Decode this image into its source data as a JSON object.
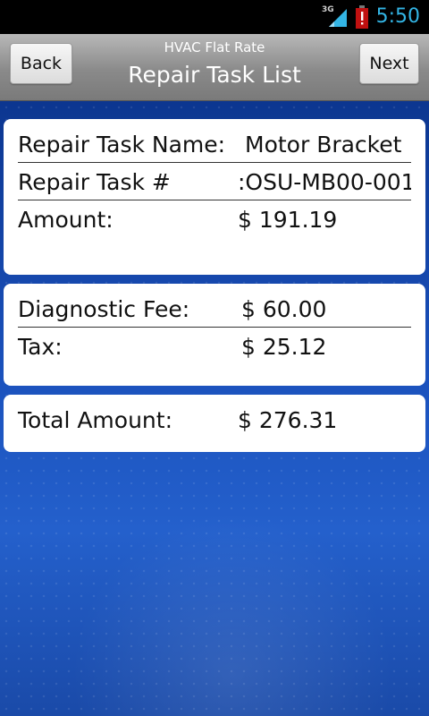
{
  "status_bar": {
    "network_type": "3G",
    "time": "5:50",
    "icons": [
      "signal-icon",
      "battery-alert-icon"
    ],
    "clock_color": "#33b5e5"
  },
  "header": {
    "app_title": "HVAC Flat Rate",
    "screen_title": "Repair Task List",
    "back_label": "Back",
    "next_label": "Next"
  },
  "task_card": {
    "rows": [
      {
        "label": "Repair Task Name:",
        "value": "Motor Bracket"
      },
      {
        "label": "Repair Task #",
        "value": ":OSU-MB00-001"
      },
      {
        "label": "Amount:",
        "value": "$ 191.19"
      }
    ]
  },
  "fees_card": {
    "rows": [
      {
        "label": "Diagnostic Fee:",
        "value": "$ 60.00"
      },
      {
        "label": "Tax:",
        "value": "$ 25.12"
      }
    ]
  },
  "total_card": {
    "label": "Total Amount:",
    "value": "$ 276.31"
  },
  "colors": {
    "background_blue": "#1a4fb8",
    "card": "#ffffff",
    "title_bar": "#8a8a8a"
  }
}
